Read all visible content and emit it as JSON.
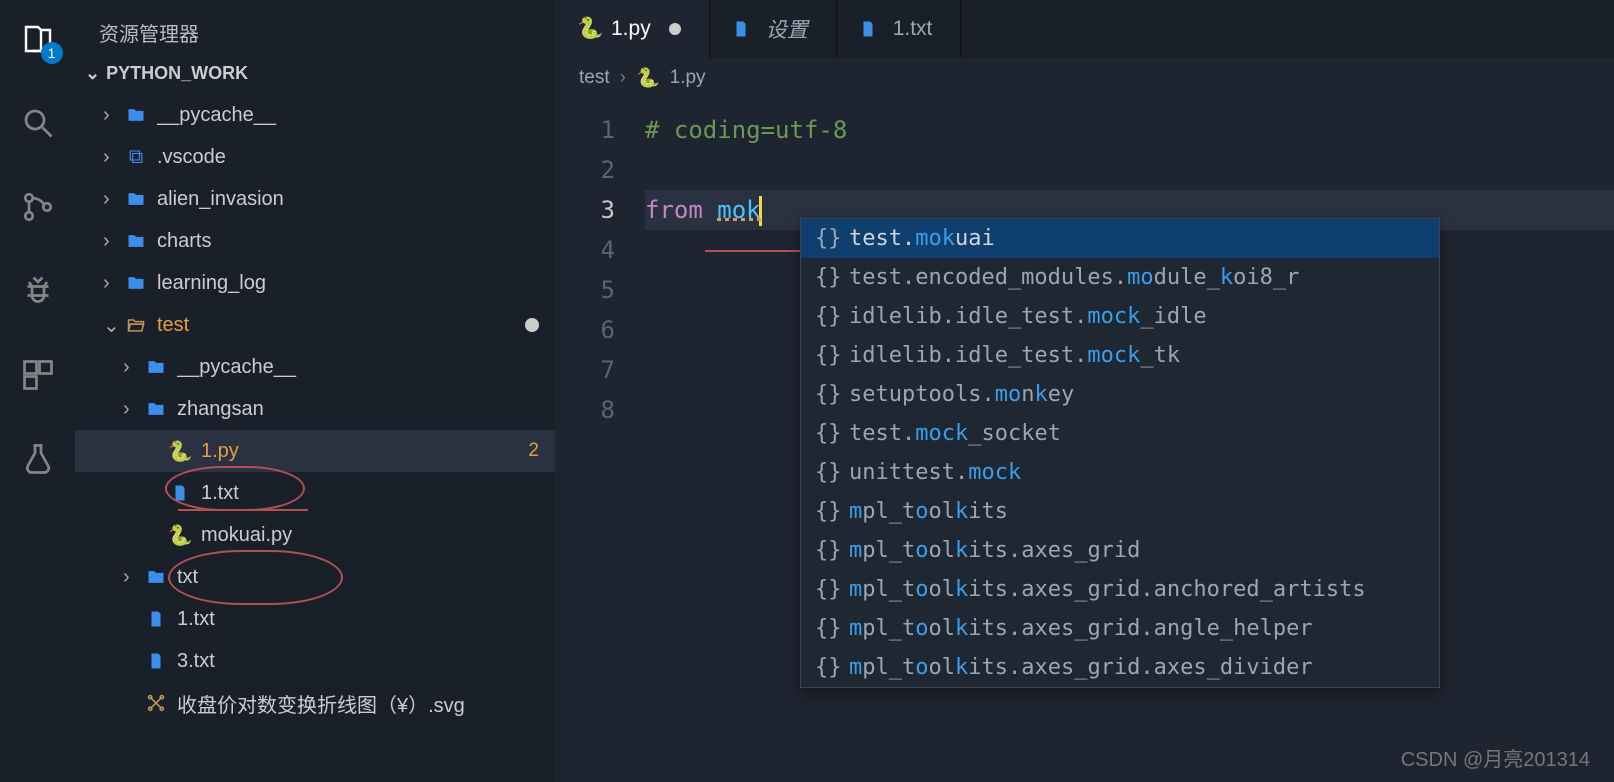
{
  "activity": {
    "explorer_badge": "1"
  },
  "sidebar": {
    "title": "资源管理器",
    "section": "PYTHON_WORK",
    "tree": [
      {
        "kind": "folder",
        "label": "__pycache__",
        "indent": 0,
        "expanded": false
      },
      {
        "kind": "vscode",
        "label": ".vscode",
        "indent": 0,
        "expanded": false
      },
      {
        "kind": "folder",
        "label": "alien_invasion",
        "indent": 0,
        "expanded": false
      },
      {
        "kind": "folder",
        "label": "charts",
        "indent": 0,
        "expanded": false
      },
      {
        "kind": "folder",
        "label": "learning_log",
        "indent": 0,
        "expanded": false
      },
      {
        "kind": "folder-open",
        "label": "test",
        "indent": 0,
        "expanded": true,
        "dirty": true,
        "color": "orange"
      },
      {
        "kind": "folder",
        "label": "__pycache__",
        "indent": 1,
        "expanded": false
      },
      {
        "kind": "folder",
        "label": "zhangsan",
        "indent": 1,
        "expanded": false
      },
      {
        "kind": "py",
        "label": "1.py",
        "indent": 2,
        "active": true,
        "color": "orange",
        "errors": "2"
      },
      {
        "kind": "txt",
        "label": "1.txt",
        "indent": 2
      },
      {
        "kind": "py",
        "label": "mokuai.py",
        "indent": 2
      },
      {
        "kind": "folder",
        "label": "txt",
        "indent": 1,
        "expanded": false
      },
      {
        "kind": "txt",
        "label": "1.txt",
        "indent": 1
      },
      {
        "kind": "txt",
        "label": "3.txt",
        "indent": 1
      },
      {
        "kind": "svg",
        "label": "收盘价对数变换折线图（¥）.svg",
        "indent": 1
      }
    ]
  },
  "tabs": [
    {
      "icon": "py",
      "label": "1.py",
      "active": true,
      "modified": true
    },
    {
      "icon": "txt",
      "label": "设置",
      "italic": true
    },
    {
      "icon": "txt",
      "label": "1.txt"
    }
  ],
  "breadcrumbs": {
    "parts": [
      "test",
      "1.py"
    ]
  },
  "editor": {
    "lines": [
      {
        "num": "1",
        "text": "# coding=utf-8",
        "cls": "tok-comment"
      },
      {
        "num": "2",
        "text": ""
      },
      {
        "num": "3",
        "from": "from",
        "mod": "mok",
        "current": true
      },
      {
        "num": "4",
        "text": ""
      },
      {
        "num": "5",
        "text": ""
      },
      {
        "num": "6",
        "text": ""
      },
      {
        "num": "7",
        "text": ""
      },
      {
        "num": "8",
        "text": ""
      }
    ]
  },
  "suggest": {
    "items": [
      {
        "parts": [
          "test.",
          "mok",
          "uai"
        ],
        "hl": [
          1
        ],
        "selected": true
      },
      {
        "parts": [
          "test.encoded_modules.",
          "mo",
          "dule_",
          "k",
          "oi8_r"
        ],
        "hl": [
          1,
          3
        ]
      },
      {
        "parts": [
          "idlelib.idle_test.",
          "mock",
          "_idle"
        ],
        "hl": [
          1
        ]
      },
      {
        "parts": [
          "idlelib.idle_test.",
          "mock",
          "_tk"
        ],
        "hl": [
          1
        ]
      },
      {
        "parts": [
          "setuptools.",
          "mo",
          "n",
          "k",
          "ey"
        ],
        "hl": [
          1,
          3
        ]
      },
      {
        "parts": [
          "test.",
          "mock",
          "_socket"
        ],
        "hl": [
          1
        ]
      },
      {
        "parts": [
          "unittest.",
          "mock"
        ],
        "hl": [
          1
        ]
      },
      {
        "parts": [
          "m",
          "pl_t",
          "o",
          "ol",
          "k",
          "its"
        ],
        "hl": [
          0,
          2,
          4
        ]
      },
      {
        "parts": [
          "m",
          "pl_t",
          "o",
          "ol",
          "k",
          "its.axes_grid"
        ],
        "hl": [
          0,
          2,
          4
        ]
      },
      {
        "parts": [
          "m",
          "pl_t",
          "o",
          "ol",
          "k",
          "its.axes_grid.anchored_artists"
        ],
        "hl": [
          0,
          2,
          4
        ]
      },
      {
        "parts": [
          "m",
          "pl_t",
          "o",
          "ol",
          "k",
          "its.axes_grid.angle_helper"
        ],
        "hl": [
          0,
          2,
          4
        ]
      },
      {
        "parts": [
          "m",
          "pl_t",
          "o",
          "ol",
          "k",
          "its.axes_grid.axes_divider"
        ],
        "hl": [
          0,
          2,
          4
        ]
      }
    ]
  },
  "watermark": "CSDN @月亮201314"
}
